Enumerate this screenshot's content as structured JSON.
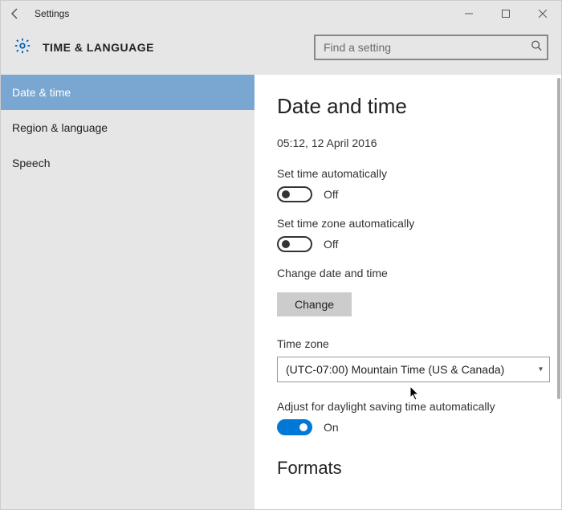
{
  "window": {
    "title": "Settings"
  },
  "header": {
    "title": "TIME & LANGUAGE"
  },
  "search": {
    "placeholder": "Find a setting"
  },
  "sidebar": {
    "items": [
      {
        "label": "Date & time",
        "active": true
      },
      {
        "label": "Region & language",
        "active": false
      },
      {
        "label": "Speech",
        "active": false
      }
    ]
  },
  "main": {
    "heading": "Date and time",
    "datetime": "05:12, 12 April 2016",
    "set_time_auto": {
      "label": "Set time automatically",
      "state": "Off",
      "on": false
    },
    "set_tz_auto": {
      "label": "Set time zone automatically",
      "state": "Off",
      "on": false
    },
    "change_dt": {
      "label": "Change date and time",
      "button": "Change"
    },
    "timezone": {
      "label": "Time zone",
      "value": "(UTC-07:00) Mountain Time (US & Canada)"
    },
    "dst": {
      "label": "Adjust for daylight saving time automatically",
      "state": "On",
      "on": true
    },
    "formats_heading": "Formats"
  },
  "colors": {
    "accent": "#0078d7",
    "sidebar_active": "#7aa7d1"
  }
}
